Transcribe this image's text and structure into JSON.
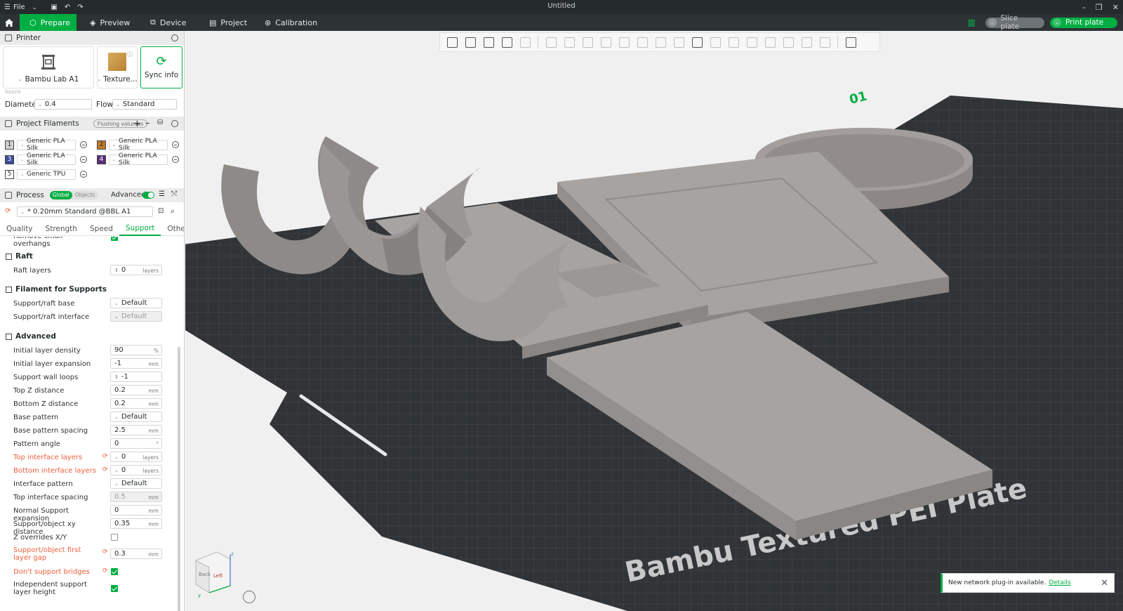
{
  "titlebar": {
    "file_label": "File",
    "title": "Untitled"
  },
  "navbar": {
    "tabs": [
      {
        "label": "Prepare",
        "icon": "cube-icon"
      },
      {
        "label": "Preview",
        "icon": "layers-icon"
      },
      {
        "label": "Device",
        "icon": "device-icon"
      },
      {
        "label": "Project",
        "icon": "project-icon"
      },
      {
        "label": "Calibration",
        "icon": "calibration-icon"
      }
    ],
    "slice_label": "Slice plate",
    "print_label": "Print plate"
  },
  "printer": {
    "section_title": "Printer",
    "printer_name": "Bambu Lab A1",
    "plate_name": "Texture...",
    "sync_label": "Sync info",
    "nozzle_label": "Nozzle",
    "diameter_label": "Diameter",
    "diameter_value": "0.4",
    "flow_label": "Flow",
    "flow_value": "Standard"
  },
  "filaments": {
    "section_title": "Project Filaments",
    "flushing_label": "Flushing volumes",
    "items": [
      {
        "num": "1",
        "name": "Generic PLA Silk",
        "color": "#d0d0d0"
      },
      {
        "num": "2",
        "name": "Generic PLA Silk",
        "color": "#c07a2a"
      },
      {
        "num": "3",
        "name": "Generic PLA Silk",
        "color": "#3c4f9a"
      },
      {
        "num": "4",
        "name": "Generic PLA Silk",
        "color": "#5a2e78"
      },
      {
        "num": "5",
        "name": "Generic TPU",
        "color": "#ffffff"
      }
    ]
  },
  "process": {
    "section_title": "Process",
    "global_label": "Global",
    "objects_label": "Objects",
    "advanced_label": "Advanced",
    "preset": "* 0.20mm Standard @BBL A1",
    "tabs": [
      "Quality",
      "Strength",
      "Speed",
      "Support",
      "Others"
    ],
    "active_tab": "Support"
  },
  "support": {
    "cutoff_label": "Remove small overhangs",
    "raft_group": "Raft",
    "raft_layers_label": "Raft layers",
    "raft_layers_value": "0",
    "filament_group": "Filament for Supports",
    "raft_base_label": "Support/raft base",
    "raft_base_value": "Default",
    "raft_interface_label": "Support/raft interface",
    "raft_interface_value": "Default",
    "advanced_group": "Advanced",
    "rows": {
      "init_density_label": "Initial layer density",
      "init_density_value": "90",
      "init_expansion_label": "Initial layer expansion",
      "init_expansion_value": "-1",
      "wall_loops_label": "Support wall loops",
      "wall_loops_value": "-1",
      "top_z_label": "Top Z distance",
      "top_z_value": "0.2",
      "bottom_z_label": "Bottom Z distance",
      "bottom_z_value": "0.2",
      "base_pattern_label": "Base pattern",
      "base_pattern_value": "Default",
      "base_spacing_label": "Base pattern spacing",
      "base_spacing_value": "2.5",
      "angle_label": "Pattern angle",
      "angle_value": "0",
      "top_if_layers_label": "Top interface layers",
      "top_if_layers_value": "0",
      "bottom_if_layers_label": "Bottom interface layers",
      "bottom_if_layers_value": "0",
      "if_pattern_label": "Interface pattern",
      "if_pattern_value": "Default",
      "top_if_spacing_label": "Top interface spacing",
      "top_if_spacing_value": "0.5",
      "normal_exp_label": "Normal Support expansion",
      "normal_exp_value": "0",
      "xy_dist_label": "Support/object xy distance",
      "xy_dist_value": "0.35",
      "z_overrides_label": "Z overrides X/Y",
      "first_gap_label": "Support/object first layer gap",
      "first_gap_value": "0.3",
      "bridges_label": "Don't support bridges",
      "indep_label": "Independent support layer height"
    },
    "units": {
      "mm": "mm",
      "pct": "%",
      "deg": "°",
      "layers": "layers"
    }
  },
  "notification": {
    "text": "New network plug-in available.",
    "link": "Details"
  },
  "plate": {
    "label": "Bambu Textured PEI Plate",
    "plate_number": "01"
  },
  "viewcube": {
    "left": "Left",
    "back": "Back",
    "z": "z",
    "y": "y"
  }
}
